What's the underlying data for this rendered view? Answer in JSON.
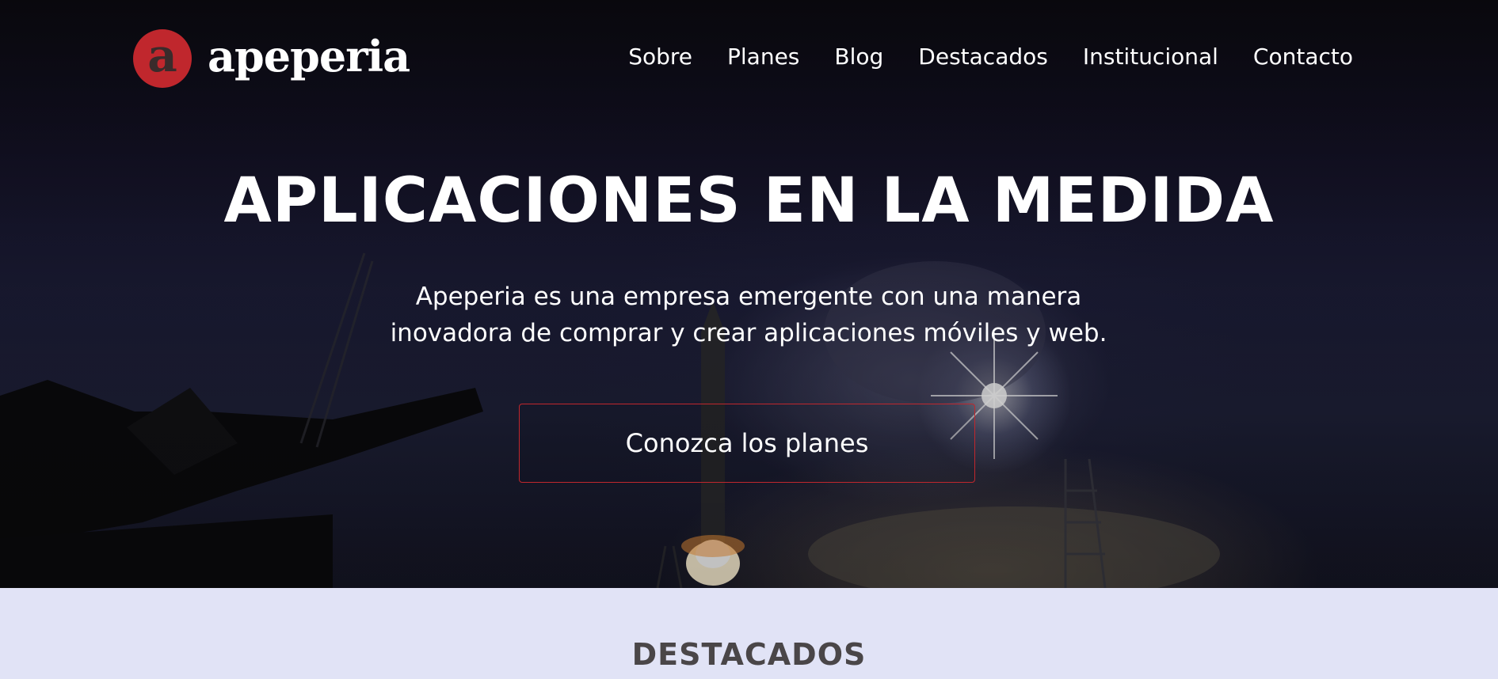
{
  "brand": {
    "logo_letter": "a",
    "name": "apeperia",
    "accent_color": "#c0272d"
  },
  "nav": {
    "items": [
      {
        "label": "Sobre"
      },
      {
        "label": "Planes"
      },
      {
        "label": "Blog"
      },
      {
        "label": "Destacados"
      },
      {
        "label": "Institucional"
      },
      {
        "label": "Contacto"
      }
    ]
  },
  "hero": {
    "headline": "APLICACIONES EN LA MEDIDA",
    "subtitle_line1": "Apeperia es una empresa emergente con una manera",
    "subtitle_line2": "inovadora de comprar y crear aplicaciones móviles y web.",
    "cta_label": "Conozca los planes"
  },
  "section": {
    "title": "DESTACADOS",
    "background_color": "#e1e3f6"
  }
}
